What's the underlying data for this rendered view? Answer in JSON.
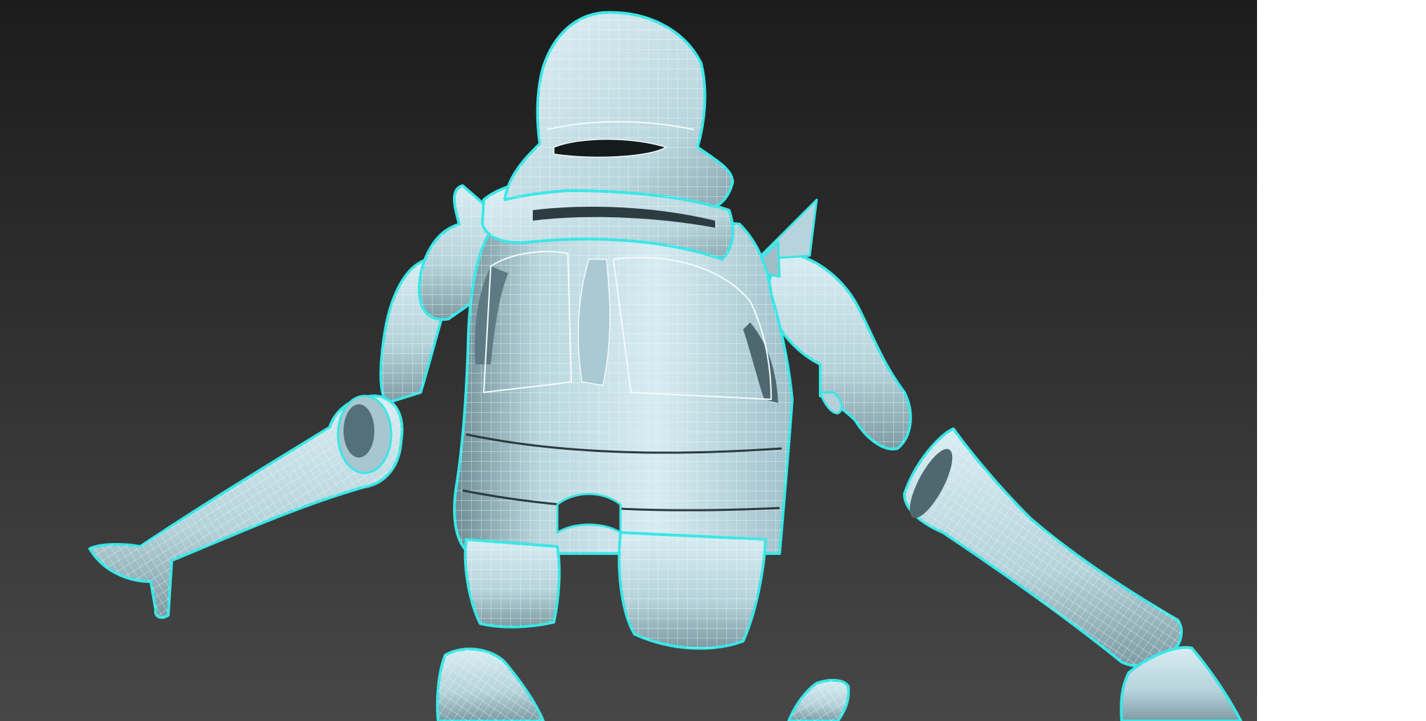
{
  "viewport": {
    "shading": "smooth-with-edged-faces",
    "selection_state": "selected",
    "colors": {
      "background_top": "#1c1c1c",
      "background_bottom": "#474747",
      "mesh_fill_light": "#d2e9ef",
      "mesh_fill_mid": "#a9c9d3",
      "mesh_fill_dark": "#4f6870",
      "wire": "#f4fbfc",
      "selection_outline": "#39e6e6",
      "right_panel": "#ffffff"
    },
    "model": {
      "subject": "armored-knight-character",
      "parts": [
        "helmet",
        "collar",
        "cuirass",
        "left-pauldron",
        "right-pauldron",
        "left-arm",
        "right-arm",
        "left-gauntlet",
        "right-gauntlet",
        "tassets",
        "left-thigh",
        "right-thigh",
        "lower-legs"
      ]
    }
  }
}
